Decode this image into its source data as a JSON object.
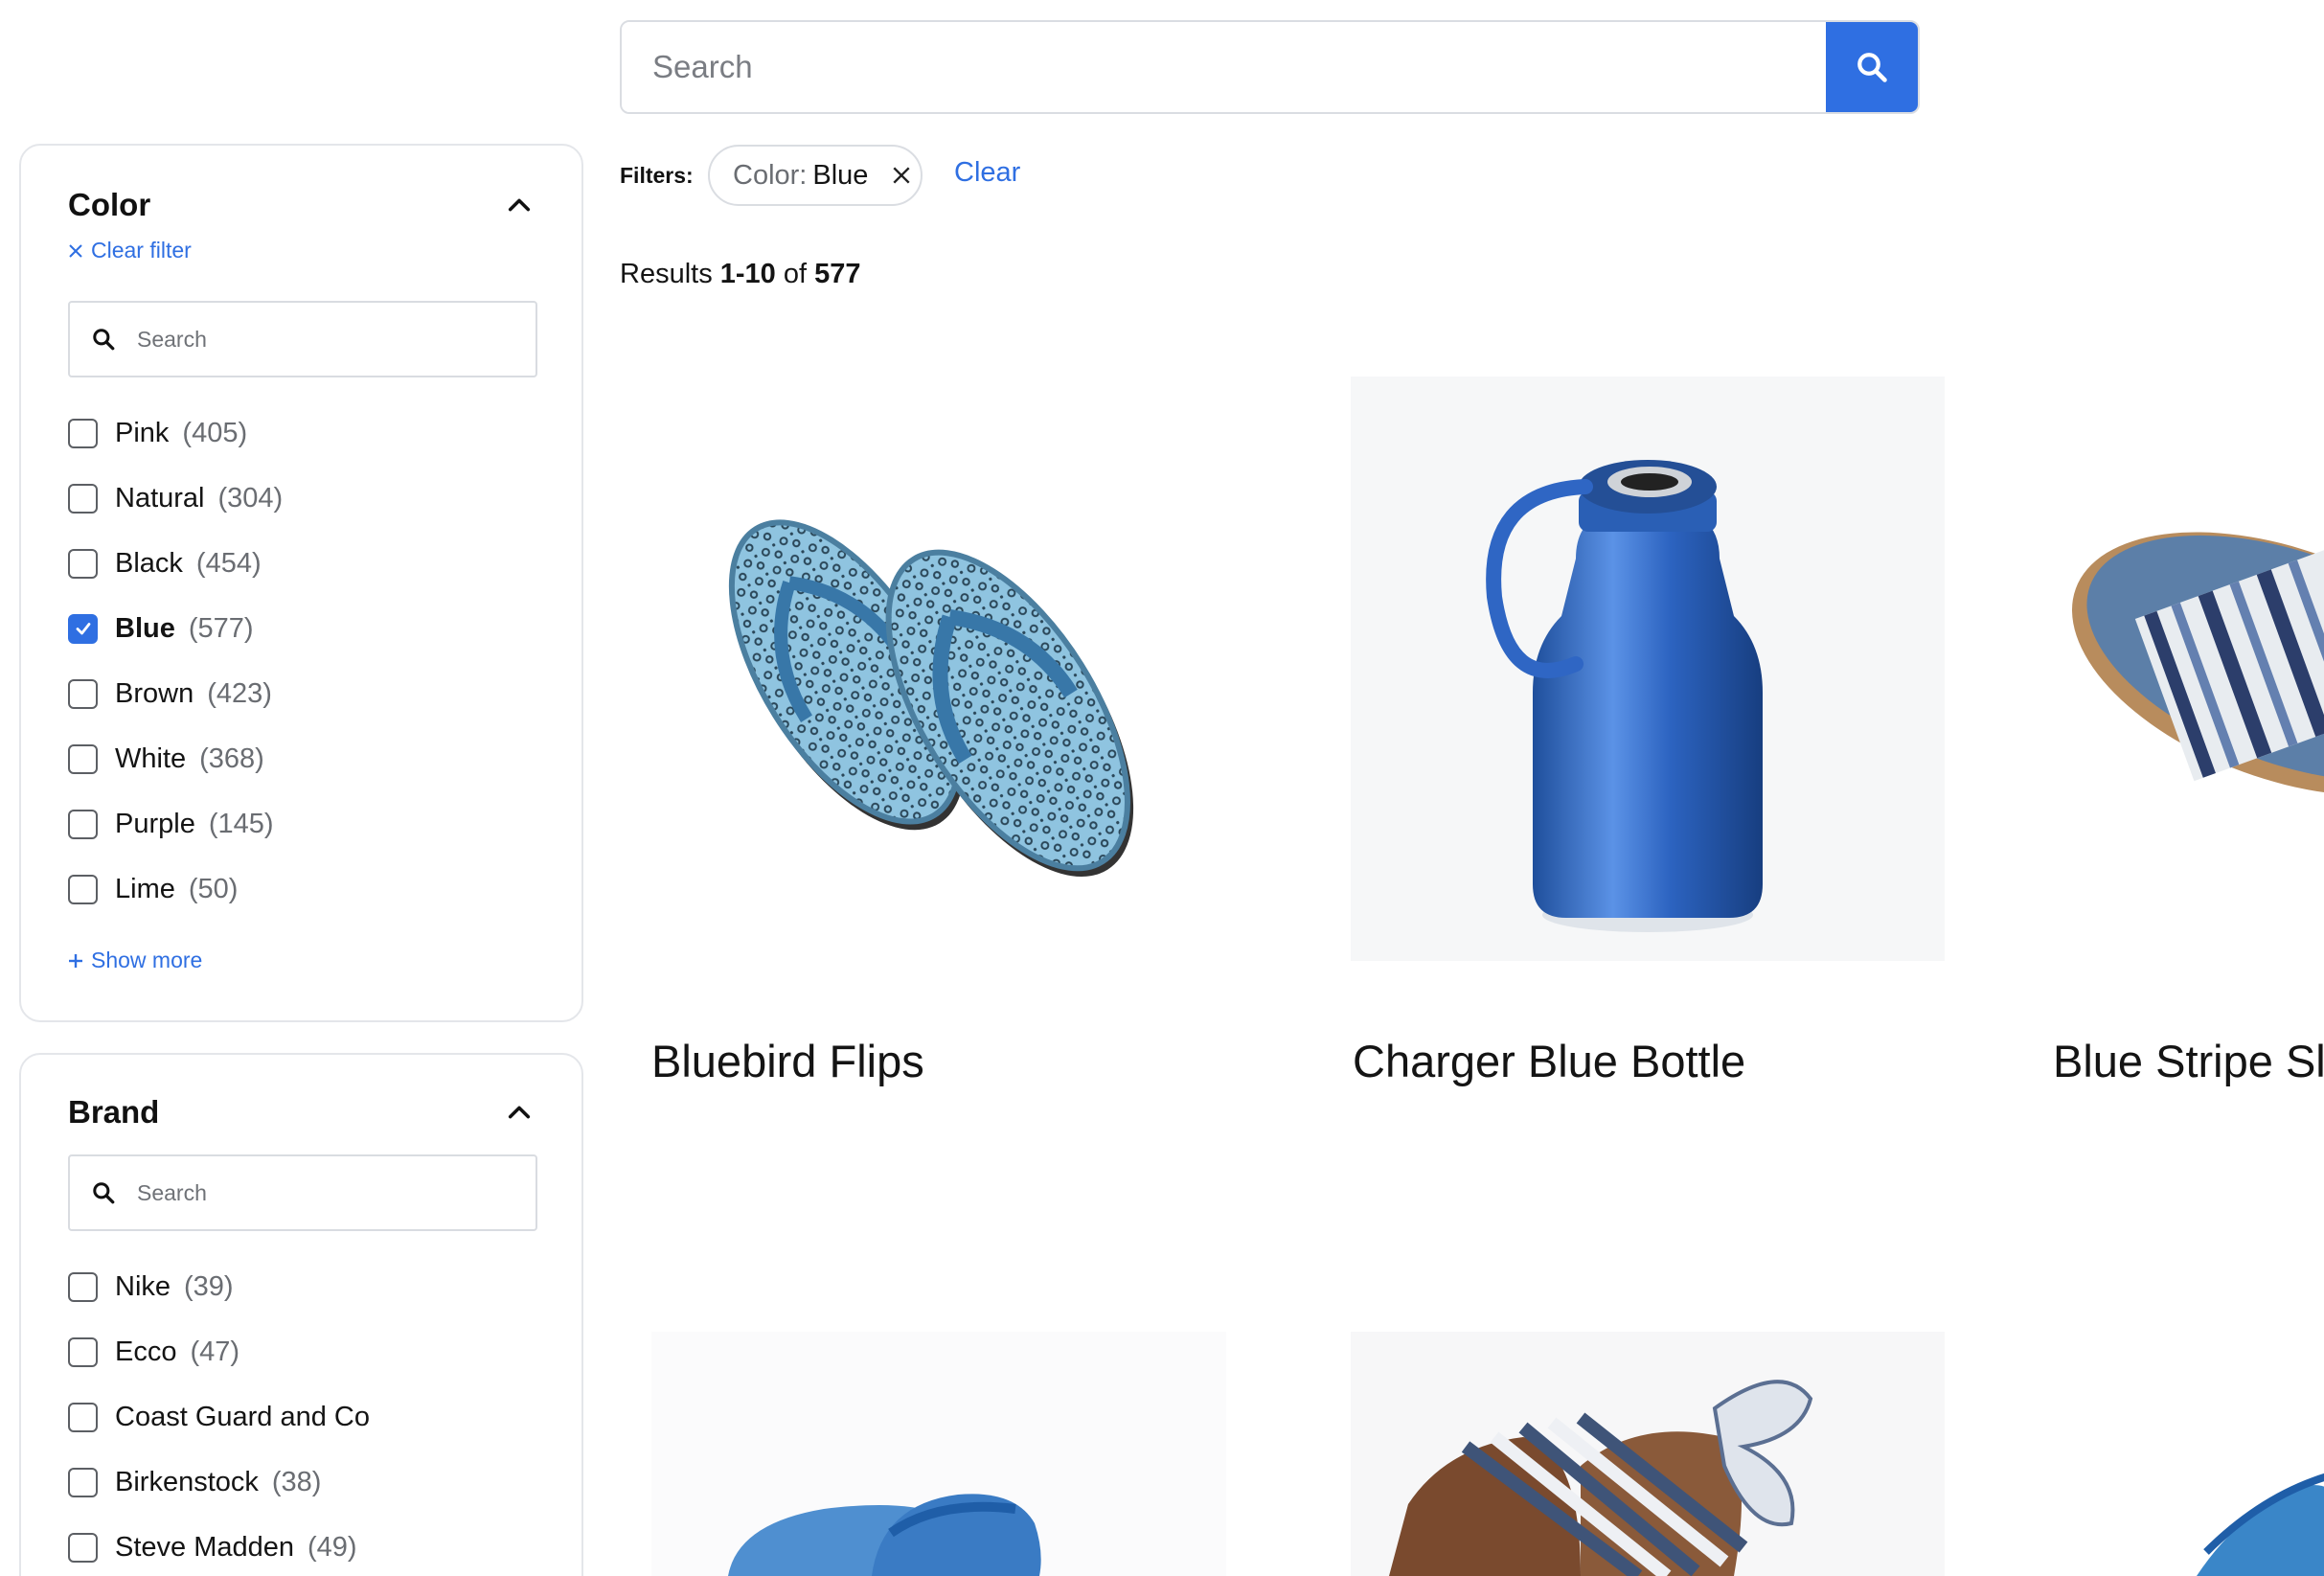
{
  "search": {
    "placeholder": "Search"
  },
  "facets": {
    "color": {
      "title": "Color",
      "clear_filter": "Clear filter",
      "search_placeholder": "Search",
      "options": [
        {
          "label": "Pink",
          "count": "(405)",
          "checked": false
        },
        {
          "label": "Natural",
          "count": "(304)",
          "checked": false
        },
        {
          "label": "Black",
          "count": "(454)",
          "checked": false
        },
        {
          "label": "Blue",
          "count": "(577)",
          "checked": true
        },
        {
          "label": "Brown",
          "count": "(423)",
          "checked": false
        },
        {
          "label": "White",
          "count": "(368)",
          "checked": false
        },
        {
          "label": "Purple",
          "count": "(145)",
          "checked": false
        },
        {
          "label": "Lime",
          "count": "(50)",
          "checked": false
        }
      ],
      "show_more": "Show more"
    },
    "brand": {
      "title": "Brand",
      "search_placeholder": "Search",
      "options": [
        {
          "label": "Nike",
          "count": "(39)",
          "checked": false
        },
        {
          "label": "Ecco",
          "count": "(47)",
          "checked": false
        },
        {
          "label": "Coast Guard and Co",
          "count": "",
          "checked": false
        },
        {
          "label": "Birkenstock",
          "count": "(38)",
          "checked": false
        },
        {
          "label": "Steve Madden",
          "count": "(49)",
          "checked": false
        }
      ]
    }
  },
  "filters": {
    "label": "Filters:",
    "chip_key": "Color:",
    "chip_value": "Blue",
    "clear": "Clear"
  },
  "results": {
    "prefix": "Results",
    "range": "1-10",
    "of": "of",
    "total": "577"
  },
  "products": [
    {
      "title": "Bluebird Flips",
      "image": "blue-leopard-flip-flops"
    },
    {
      "title": "Charger Blue Bottle",
      "image": "blue-water-bottle"
    },
    {
      "title": "Blue Stripe Sli",
      "image": "blue-stripe-slides"
    },
    {
      "title": "",
      "image": "blue-clogs"
    },
    {
      "title": "",
      "image": "striped-bow-sandals"
    },
    {
      "title": "",
      "image": "blue-sandal"
    }
  ],
  "colors": {
    "accent": "#2f6fe2",
    "text": "#141414",
    "muted": "#6a6d72",
    "border": "#dadde2"
  }
}
